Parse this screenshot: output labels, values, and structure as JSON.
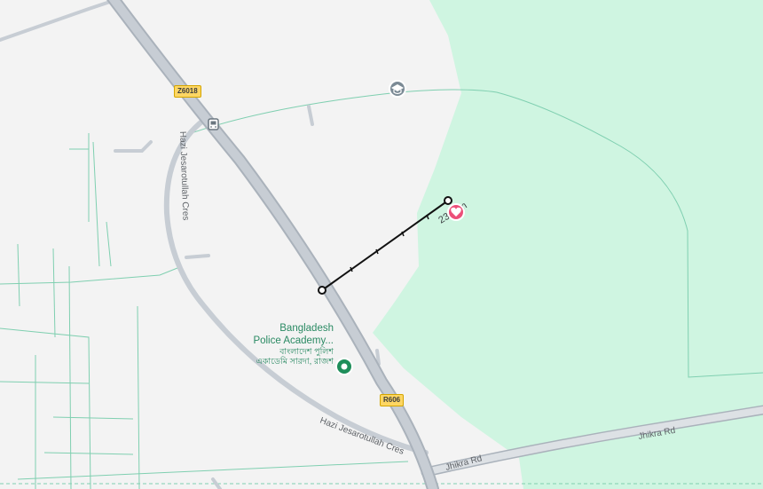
{
  "map": {
    "colors": {
      "background": "#f3f3f3",
      "forest": "#cff5e1",
      "road_fill": "#c7cdd4",
      "road_edge": "#aab2bb",
      "path": "#7fcfb0",
      "measure_line": "#111111",
      "poi_green": "#1e8e5a",
      "heart_pin": "#ec4f79"
    },
    "road_labels": {
      "hazi_left": "Hazi Jesarotullah Cres",
      "hazi_bottom": "Hazi Jesarotullah Cres",
      "jhikra_1": "Jhikra Rd",
      "jhikra_2": "Jhikra Rd"
    },
    "shields": {
      "z6018": "Z6018",
      "r606": "R606"
    },
    "poi": {
      "name_line1": "Bangladesh",
      "name_line2": "Police Academy...",
      "name_bn_line1": "বাংলাদেশ পুলিশ",
      "name_bn_line2": "একাডেমি সারদা, রাজশ",
      "icon": "map-pin-icon"
    },
    "measurement": {
      "distance_label": "23",
      "distance_label_tail": "m"
    },
    "icons": {
      "school": "graduation-cap-icon",
      "bus": "bus-stop-icon",
      "favorite": "heart-pin-icon"
    }
  }
}
